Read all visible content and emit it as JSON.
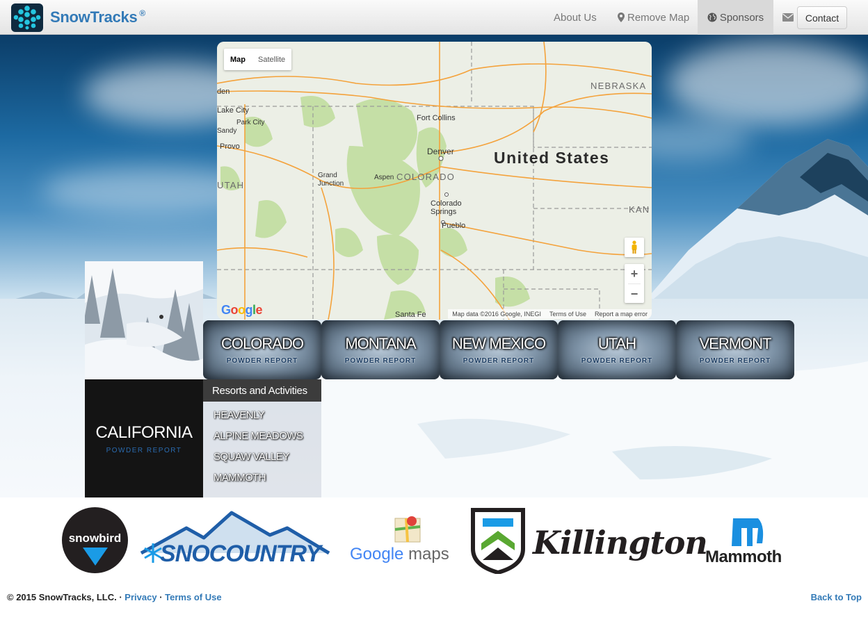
{
  "brand": {
    "name": "SnowTracks",
    "reg": "®"
  },
  "nav": {
    "about": "About Us",
    "remove_map": "Remove Map",
    "sponsors": "Sponsors",
    "contact": "Contact"
  },
  "map": {
    "type_map": "Map",
    "type_satellite": "Satellite",
    "country_label": "United States",
    "labels": {
      "nebraska": "NEBRASKA",
      "kan": "KAN",
      "utah": "UTAH",
      "colorado": "COLORADO",
      "den": "den",
      "lake_city": "Lake City",
      "park_city": "Park City",
      "sandy": "Sandy",
      "provo": "Provo",
      "fort_collins": "Fort Collins",
      "denver": "Denver",
      "grand_junction": "Grand\nJunction",
      "aspen": "Aspen",
      "colorado_springs": "Colorado\nSprings",
      "pueblo": "Pueblo",
      "santa_fe": "Santa Fe"
    },
    "google": "Google",
    "footer": {
      "data": "Map data ©2016 Google, INEGI",
      "terms": "Terms of Use",
      "report": "Report a map error"
    }
  },
  "states": [
    {
      "name": "COLORADO",
      "sub": "POWDER REPORT"
    },
    {
      "name": "MONTANA",
      "sub": "POWDER REPORT"
    },
    {
      "name": "NEW MEXICO",
      "sub": "POWDER REPORT"
    },
    {
      "name": "UTAH",
      "sub": "POWDER REPORT"
    },
    {
      "name": "VERMONT",
      "sub": "POWDER REPORT"
    }
  ],
  "california": {
    "name": "CALIFORNIA",
    "sub": "POWDER REPORT"
  },
  "resorts": {
    "heading": "Resorts and Activities",
    "items": [
      "HEAVENLY",
      "ALPINE MEADOWS",
      "SQUAW VALLEY",
      "MAMMOTH"
    ]
  },
  "sponsors": {
    "snowbird": "snowbird",
    "snocountry": "SNOCOUNTRY",
    "google_maps_google": "Google",
    "google_maps_maps": "maps",
    "killington": "Killington",
    "mammoth": "Mammoth"
  },
  "footer": {
    "copyright": "© 2015 SnowTracks, LLC.",
    "sep": "·",
    "privacy": "Privacy",
    "terms": "Terms of Use",
    "back_to_top": "Back to Top"
  },
  "colors": {
    "brand": "#337ab7",
    "nav_active": "#d9d9d9",
    "dark_card": "#141414",
    "map_road": "#f4a23b"
  }
}
